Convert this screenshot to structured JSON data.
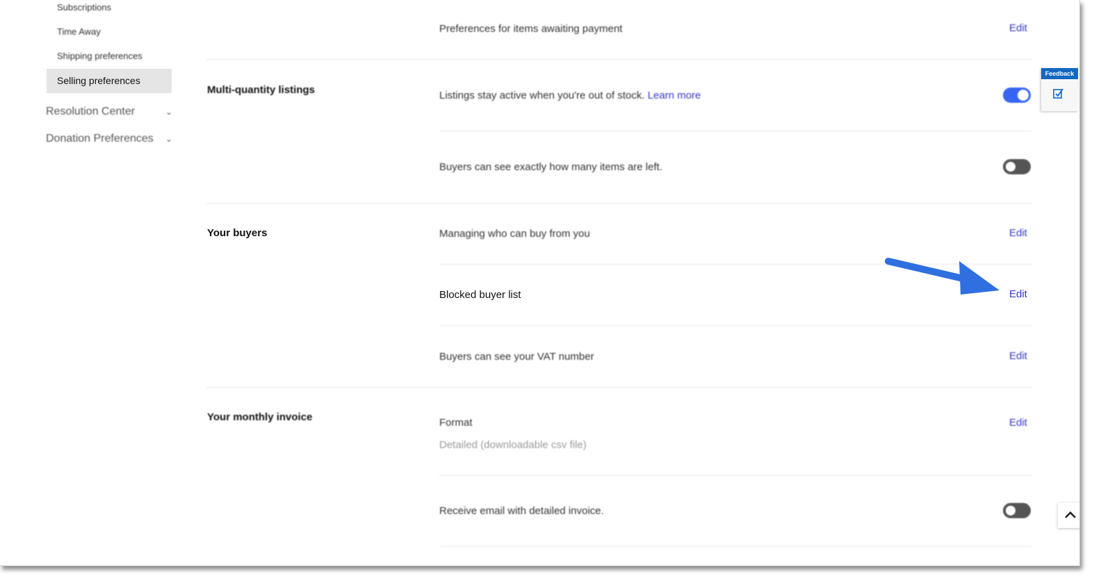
{
  "sidebar": {
    "sub_items": [
      {
        "label": "Subscriptions"
      },
      {
        "label": "Time Away"
      },
      {
        "label": "Shipping preferences"
      }
    ],
    "active_item": {
      "label": "Selling preferences"
    },
    "top_items": [
      {
        "label": "Resolution Center"
      },
      {
        "label": "Donation Preferences"
      }
    ]
  },
  "rows": {
    "awaiting_payment": {
      "label": "Preferences for items awaiting payment",
      "edit": "Edit"
    },
    "multi_quantity": {
      "title": "Multi-quantity listings",
      "stay_active": {
        "label": "Listings stay active when you're out of stock.",
        "link": "Learn more",
        "enabled": true
      },
      "items_left": {
        "label": "Buyers can see exactly how many items are left.",
        "enabled": false
      }
    },
    "your_buyers": {
      "title": "Your buyers",
      "managing": {
        "label": "Managing who can buy from you",
        "edit": "Edit"
      },
      "blocked": {
        "label": "Blocked buyer list",
        "edit": "Edit"
      },
      "vat": {
        "label": "Buyers can see your VAT number",
        "edit": "Edit"
      }
    },
    "monthly_invoice": {
      "title": "Your monthly invoice",
      "format": {
        "label": "Format",
        "value": "Detailed (downloadable csv file)",
        "edit": "Edit"
      },
      "email": {
        "label": "Receive email with detailed invoice.",
        "enabled": false
      }
    }
  },
  "feedback": {
    "label": "Feedback"
  },
  "colors": {
    "accent": "#3665f3",
    "link": "#3535cc",
    "annotation_arrow": "#2f6fe0"
  }
}
